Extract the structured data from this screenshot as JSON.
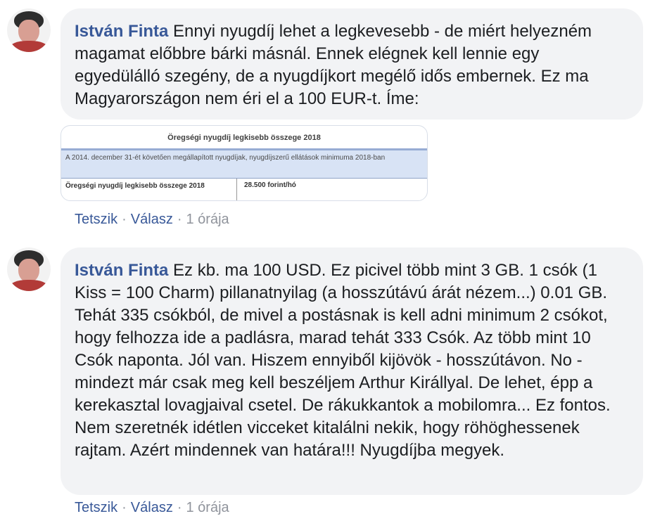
{
  "comments": [
    {
      "author": "István Finta",
      "text": "Ennyi nyugdíj lehet a legkevesebb - de miért helyezném magamat előbbre bárki másnál. Ennek elégnek kell lennie egy egyedülálló szegény, de a nyugdíjkort megélő idős embernek. Ez ma Magyarországon nem éri el a 100 EUR-t. Íme:",
      "attachment": {
        "title": "Öregségi nyugdíj legkisebb összege 2018",
        "note": "A 2014. december 31-ét követően megállapított nyugdíjak, nyugdíjszerű ellátások minimuma 2018-ban",
        "row_label": "Öregségi nyugdíj legkisebb összege 2018",
        "row_value": "28.500 forint/hó"
      },
      "like_label": "Tetszik",
      "reply_label": "Válasz",
      "separator": "·",
      "time": "1 órája"
    },
    {
      "author": "István Finta",
      "text": "Ez kb. ma 100 USD. Ez picivel több mint 3 GB. 1 csók (1 Kiss = 100 Charm) pillanatnyilag (a hosszútávú árát nézem...) 0.01 GB. Tehát 335 csókból, de mivel a postásnak is kell adni minimum 2 csókot, hogy felhozza ide a padlásra, marad tehát 333 Csók. Az több mint 10 Csók naponta. Jól van. Hiszem ennyiből kijövök - hosszútávon. No - mindezt már csak meg kell beszéljem Arthur Királlyal. De lehet, épp a kerekasztal lovagjaival csetel. De rákukkantok a mobilomra... Ez fontos. Nem szeretnék idétlen vicceket kitalálni nekik, hogy röhöghessenek rajtam. Azért mindennek van határa!!! Nyugdíjba megyek.",
      "like_label": "Tetszik",
      "reply_label": "Válasz",
      "separator": "·",
      "time": "1 órája"
    }
  ],
  "colors": {
    "author": "#385898",
    "bubble_bg": "#f2f3f5",
    "meta": "#90949c"
  }
}
